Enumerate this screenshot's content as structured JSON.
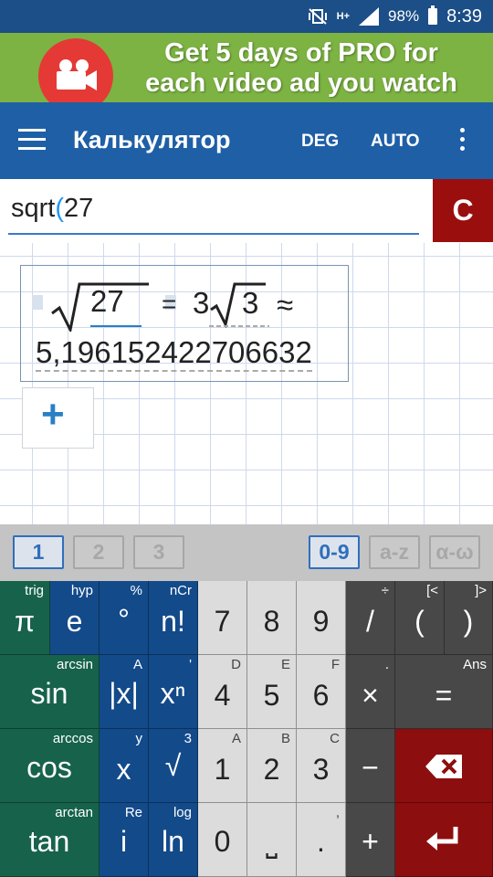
{
  "status": {
    "time": "8:39",
    "battery": "98%",
    "network": "H+"
  },
  "ad": {
    "line1": "Get 5 days of PRO for",
    "line2": "each video ad you watch"
  },
  "appbar": {
    "title": "Калькулятор",
    "deg": "DEG",
    "auto": "AUTO"
  },
  "input": {
    "text": "sqrt",
    "paren": "(",
    "arg": "27",
    "clear": "C"
  },
  "result": {
    "radicand": "27",
    "equals": "=",
    "coef": "3",
    "simplified_radicand": "3",
    "approx": "≈",
    "decimal": "5,196152422706632"
  },
  "add_label": "+",
  "tabs": {
    "t1": "1",
    "t2": "2",
    "t3": "3",
    "digits": "0-9",
    "latin": "a-z",
    "greek": "α-ω"
  },
  "keys": {
    "r1": [
      {
        "main": "π",
        "sub": "trig"
      },
      {
        "main": "e",
        "sub": "hyp"
      },
      {
        "main": "°",
        "sub": "%"
      },
      {
        "main": "n!",
        "sub": "nCr"
      },
      {
        "main": "7",
        "sub": ""
      },
      {
        "main": "8",
        "sub": ""
      },
      {
        "main": "9",
        "sub": ""
      },
      {
        "main": "/",
        "sub": "÷"
      },
      {
        "main": "(",
        "sub": "[<"
      },
      {
        "main": ")",
        "sub": "]>"
      }
    ],
    "r2": [
      {
        "main": "sin",
        "sub": "arcsin"
      },
      {
        "main": "|x|",
        "sub": "A"
      },
      {
        "main": "xⁿ",
        "sub": "'"
      },
      {
        "main": "4",
        "sub": "D"
      },
      {
        "main": "5",
        "sub": "E"
      },
      {
        "main": "6",
        "sub": "F"
      },
      {
        "main": "×",
        "sub": "."
      },
      {
        "main": "=",
        "sub": "Ans"
      }
    ],
    "r3": [
      {
        "main": "cos",
        "sub": "arccos"
      },
      {
        "main": "x",
        "sub": "y"
      },
      {
        "main": "√",
        "sub": "3"
      },
      {
        "main": "1",
        "sub": "A"
      },
      {
        "main": "2",
        "sub": "B"
      },
      {
        "main": "3",
        "sub": "C"
      },
      {
        "main": "−",
        "sub": ""
      },
      {
        "main": "⌫",
        "sub": ""
      }
    ],
    "r4": [
      {
        "main": "tan",
        "sub": "arctan"
      },
      {
        "main": "i",
        "sub": "Re"
      },
      {
        "main": "ln",
        "sub": "log"
      },
      {
        "main": "0",
        "sub": ""
      },
      {
        "main": "⎵",
        "sub": ""
      },
      {
        "main": ".",
        "sub": ","
      },
      {
        "main": "+",
        "sub": ""
      },
      {
        "main": "↵",
        "sub": ""
      }
    ]
  }
}
